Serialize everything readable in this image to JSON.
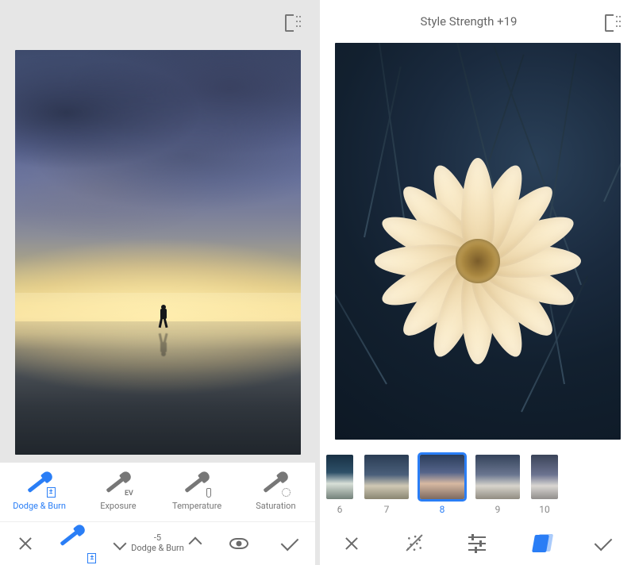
{
  "left": {
    "topbar": {
      "compare_icon": "compare-icon"
    },
    "tools": [
      {
        "key": "dodgeburn",
        "label": "Dodge & Burn",
        "badge": "±",
        "active": true
      },
      {
        "key": "exposure",
        "label": "Exposure",
        "badge": "EV",
        "active": false
      },
      {
        "key": "temperature",
        "label": "Temperature",
        "badge": "therm",
        "active": false
      },
      {
        "key": "saturation",
        "label": "Saturation",
        "badge": "gear",
        "active": false
      }
    ],
    "stepper": {
      "value": "-5",
      "label": "Dodge & Burn"
    },
    "actions": {
      "cancel": "×",
      "brush": "brush",
      "preview": "eye",
      "apply": "✓"
    }
  },
  "right": {
    "topbar": {
      "title": "Style Strength +19",
      "compare_icon": "compare-icon"
    },
    "styles": [
      {
        "num": "6",
        "swatch": "sw6",
        "selected": false,
        "cut": true
      },
      {
        "num": "7",
        "swatch": "sw7",
        "selected": false
      },
      {
        "num": "8",
        "swatch": "sw8",
        "selected": true
      },
      {
        "num": "9",
        "swatch": "sw9",
        "selected": false
      },
      {
        "num": "10",
        "swatch": "sw10",
        "selected": false,
        "cut": true
      }
    ],
    "actions": {
      "cancel": "×",
      "grain": "grain",
      "adjust": "sliders",
      "styles": "card",
      "apply": "✓"
    }
  }
}
